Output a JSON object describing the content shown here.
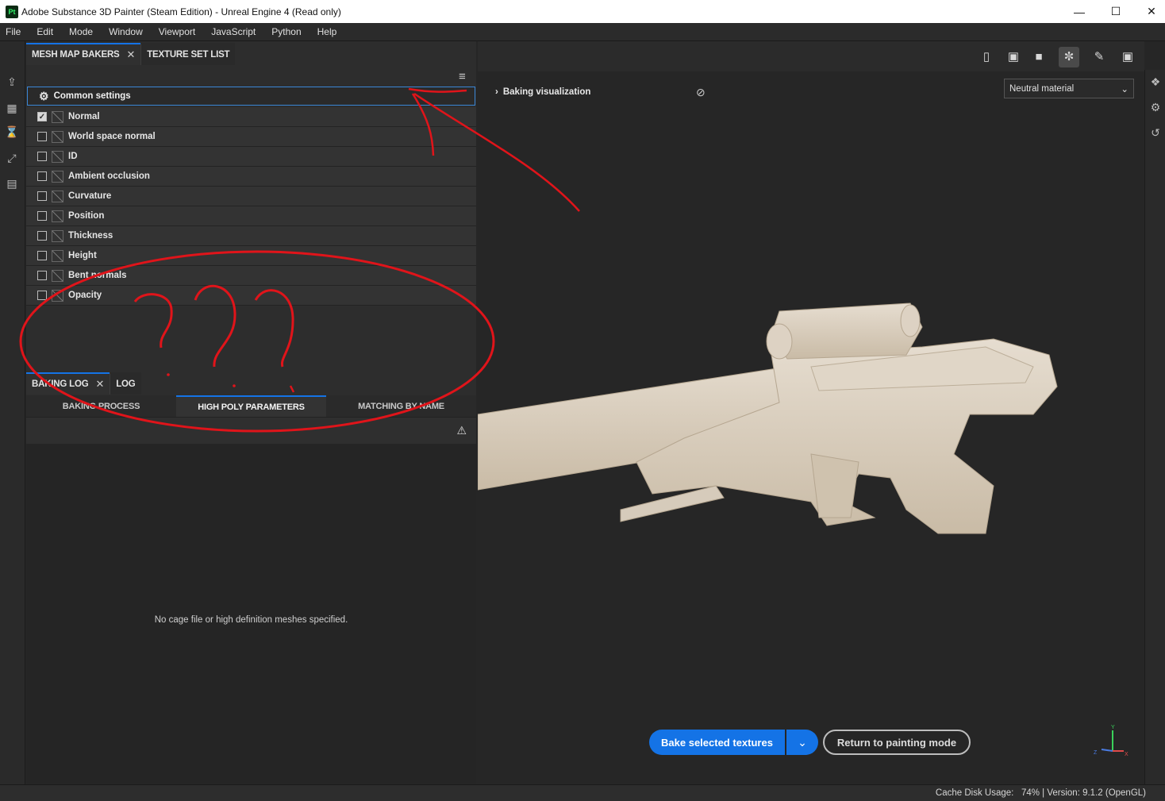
{
  "window": {
    "title": "Adobe Substance 3D Painter (Steam Edition) - Unreal Engine 4 (Read only)",
    "logo_text": "Pt"
  },
  "menu": [
    "File",
    "Edit",
    "Mode",
    "Window",
    "Viewport",
    "JavaScript",
    "Python",
    "Help"
  ],
  "left_panel": {
    "tabs": [
      {
        "label": "MESH MAP BAKERS",
        "active": true,
        "closable": true
      },
      {
        "label": "TEXTURE SET LIST",
        "active": false
      }
    ],
    "common_settings": "Common settings",
    "maps": [
      {
        "label": "Normal",
        "checked": true
      },
      {
        "label": "World space normal",
        "checked": false
      },
      {
        "label": "ID",
        "checked": false
      },
      {
        "label": "Ambient occlusion",
        "checked": false
      },
      {
        "label": "Curvature",
        "checked": false
      },
      {
        "label": "Position",
        "checked": false
      },
      {
        "label": "Thickness",
        "checked": false
      },
      {
        "label": "Height",
        "checked": false
      },
      {
        "label": "Bent normals",
        "checked": false
      },
      {
        "label": "Opacity",
        "checked": false
      }
    ]
  },
  "log_panel": {
    "tabs": [
      {
        "label": "BAKING LOG",
        "active": true
      },
      {
        "label": "LOG",
        "active": false
      }
    ],
    "subtabs": [
      {
        "label": "BAKING PROCESS"
      },
      {
        "label": "HIGH POLY PARAMETERS",
        "selected": true
      },
      {
        "label": "MATCHING BY NAME"
      }
    ],
    "message": "No cage file or high definition meshes specified."
  },
  "viewport": {
    "baking_visualization": "Baking visualization",
    "material_select": "Neutral material",
    "bake_button": "Bake selected textures",
    "return_button": "Return to painting mode",
    "accent": "#1473e6",
    "gizmo_labels": {
      "x": "X",
      "y": "Y",
      "z": "Z"
    }
  },
  "status": {
    "label": "Cache Disk Usage:",
    "value": "74% | Version: 9.1.2 (OpenGL)"
  },
  "icons": [
    "gear-icon",
    "checkbox-icon",
    "map-thumbnail-icon",
    "close-icon",
    "hamburger-menu-icon",
    "warning-icon",
    "eye-off-icon",
    "chevron-right-icon",
    "chevron-down-icon",
    "perspective-icon",
    "cube-icon",
    "camera-icon",
    "paint-mode-icon",
    "brush-icon",
    "screenshot-icon",
    "export-icon",
    "history-icon",
    "axis-gizmo"
  ]
}
